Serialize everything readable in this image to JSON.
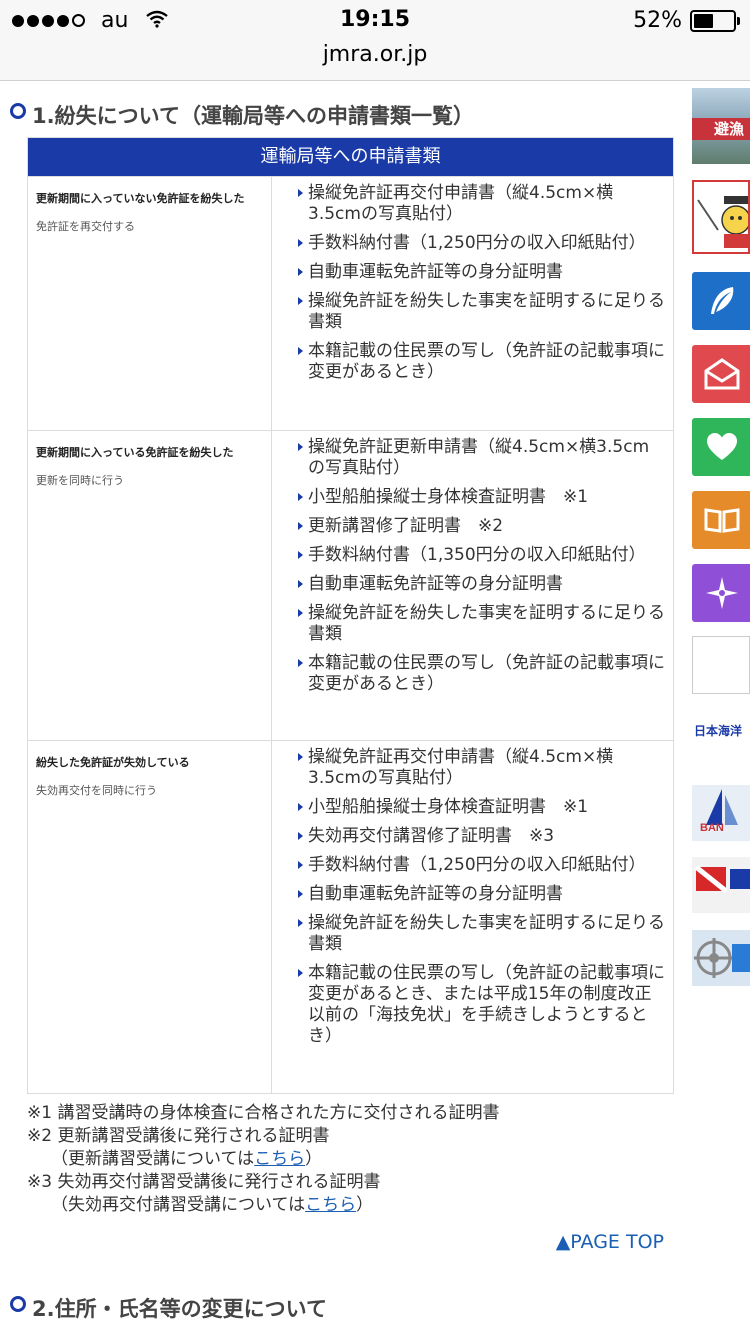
{
  "status_bar": {
    "carrier": "au",
    "time": "19:15",
    "battery_percent": "52%",
    "battery_level": 0.52
  },
  "url_bar": {
    "domain": "jmra.or.jp"
  },
  "section1": {
    "title": "1.紛失について（運輸局等への申請書類一覧）",
    "table_header": "運輸局等への申請書類",
    "rows": [
      {
        "condition": "更新期間に入っていない免許証を紛失した",
        "action": "免許証を再交付する",
        "items": [
          "操縦免許証再交付申請書（縦4.5cm×横3.5cmの写真貼付）",
          "手数料納付書（1,250円分の収入印紙貼付）",
          "自動車運転免許証等の身分証明書",
          "操縦免許証を紛失した事実を証明するに足りる書類",
          "本籍記載の住民票の写し（免許証の記載事項に変更があるとき）"
        ]
      },
      {
        "condition": "更新期間に入っている免許証を紛失した",
        "action": "更新を同時に行う",
        "items": [
          "操縦免許証更新申請書（縦4.5cm×横3.5cmの写真貼付）",
          "小型船舶操縦士身体検査証明書　※1",
          "更新講習修了証明書　※2",
          "手数料納付書（1,350円分の収入印紙貼付）",
          "自動車運転免許証等の身分証明書",
          "操縦免許証を紛失した事実を証明するに足りる書類",
          "本籍記載の住民票の写し（免許証の記載事項に変更があるとき）"
        ]
      },
      {
        "condition": "紛失した免許証が失効している",
        "action": "失効再交付を同時に行う",
        "items": [
          "操縦免許証再交付申請書（縦4.5cm×横3.5cmの写真貼付）",
          "小型船舶操縦士身体検査証明書　※1",
          "失効再交付講習修了証明書　※3",
          "手数料納付書（1,250円分の収入印紙貼付）",
          "自動車運転免許証等の身分証明書",
          "操縦免許証を紛失した事実を証明するに足りる書類",
          "本籍記載の住民票の写し（免許証の記載事項に変更があるとき、または平成15年の制度改正以前の「海技免状」を手続きしようとするとき）"
        ]
      }
    ]
  },
  "notes": {
    "n1": "※1 講習受講時の身体検査に合格された方に交付される証明書",
    "n2": "※2 更新講習受講後に発行される証明書",
    "n2_sub_pre": "（更新講習受講については",
    "n2_link": "こちら",
    "n2_sub_post": "）",
    "n3": "※3 失効再交付講習受講後に発行される証明書",
    "n3_sub_pre": "（失効再交付講習受講については",
    "n3_link": "こちら",
    "n3_sub_post": "）"
  },
  "page_top": "▲PAGE TOP",
  "section2": {
    "title": "2.住所・氏名等の変更について"
  },
  "sidebar": {
    "banner_text": "避漁",
    "label": "日本海洋",
    "buttons": [
      {
        "icon": "feather-icon",
        "color": "#1e6fc8"
      },
      {
        "icon": "mail-icon",
        "color": "#e0494e"
      },
      {
        "icon": "heart-icon",
        "color": "#2fb65a"
      },
      {
        "icon": "book-icon",
        "color": "#e68b2a"
      },
      {
        "icon": "compass-star-icon",
        "color": "#8f4fd6"
      }
    ]
  }
}
